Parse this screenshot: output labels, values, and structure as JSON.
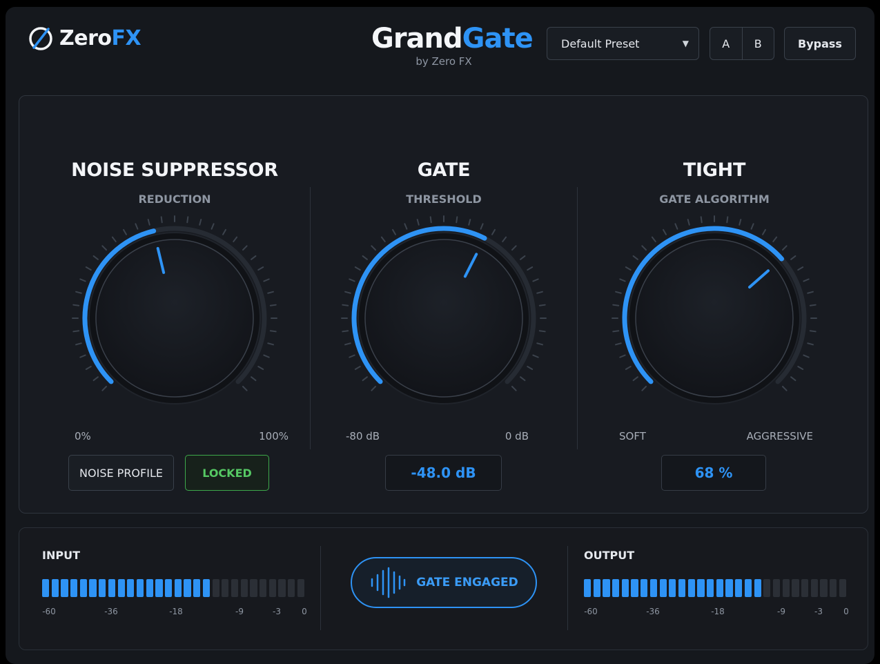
{
  "header": {
    "logo_text_white": "Zero",
    "logo_text_blue": "FX",
    "title_white": "Grand",
    "title_blue": "Gate",
    "subtitle": "by Zero FX",
    "preset_value": "Default Preset",
    "ab": [
      "A",
      "B"
    ],
    "bypass_label": "Bypass"
  },
  "colors": {
    "accent": "#2e93f5",
    "green": "#3ea94b",
    "background": "#15181d"
  },
  "sections": [
    {
      "title": "NOISE SUPPRESSOR",
      "subtitle": "REDUCTION",
      "range_min": "0%",
      "range_max": "100%",
      "knob_fraction": 0.45,
      "noise_profile_label": "NOISE PROFILE",
      "locked_label": "LOCKED"
    },
    {
      "title": "GATE",
      "subtitle": "THRESHOLD",
      "range_min": "-80 dB",
      "range_max": "0 dB",
      "knob_fraction": 0.6,
      "value": "-48.0 dB"
    },
    {
      "title": "TIGHT",
      "subtitle": "GATE ALGORITHM",
      "range_min": "SOFT",
      "range_max": "AGGRESSIVE",
      "knob_fraction": 0.68,
      "value": "68 %"
    }
  ],
  "meters": {
    "input": {
      "label": "INPUT",
      "segments": 28,
      "lit": 18,
      "scale": [
        "-60",
        "-36",
        "-18",
        "-9",
        "-3",
        "0"
      ]
    },
    "output": {
      "label": "OUTPUT",
      "segments": 28,
      "lit": 19,
      "scale": [
        "-60",
        "-36",
        "-18",
        "-9",
        "-3",
        "0"
      ]
    },
    "gate_status": "GATE ENGAGED"
  }
}
